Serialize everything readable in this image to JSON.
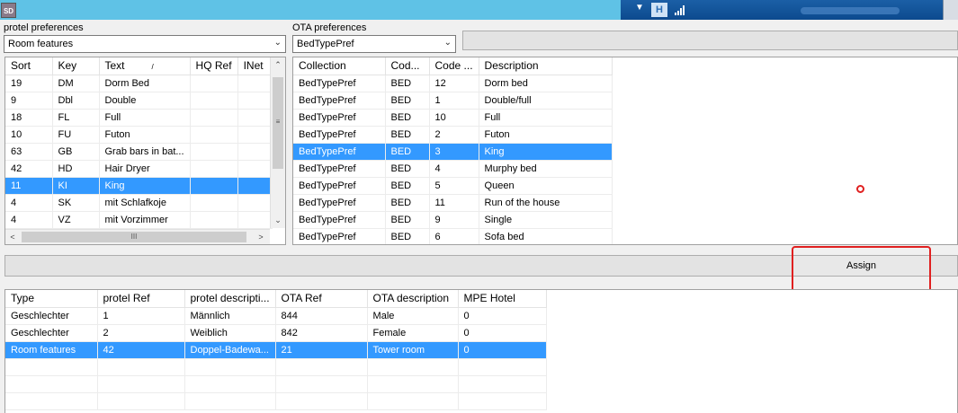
{
  "app": {
    "icon_text": "SD"
  },
  "taskbar": {
    "tray_h": "H"
  },
  "left": {
    "label": "protel preferences",
    "combo_value": "Room features",
    "columns": [
      "Sort",
      "Key",
      "Text",
      "HQ Ref",
      "INet"
    ],
    "sort_indicator": "/",
    "rows": [
      [
        "19",
        "DM",
        "Dorm Bed",
        "",
        ""
      ],
      [
        "9",
        "Dbl",
        "Double",
        "",
        ""
      ],
      [
        "18",
        "FL",
        "Full",
        "",
        ""
      ],
      [
        "10",
        "FU",
        "Futon",
        "",
        ""
      ],
      [
        "63",
        "GB",
        "Grab bars in bat...",
        "",
        ""
      ],
      [
        "42",
        "HD",
        "Hair Dryer",
        "",
        ""
      ],
      [
        "11",
        "KI",
        "King",
        "",
        ""
      ],
      [
        "4",
        "SK",
        "mit Schlafkoje",
        "",
        ""
      ],
      [
        "4",
        "VZ",
        "mit Vorzimmer",
        "",
        ""
      ]
    ],
    "selected_row": 6,
    "hscroll_grip": "III"
  },
  "ota": {
    "label": "OTA preferences",
    "combo_value": "BedTypePref",
    "columns": [
      "Collection",
      "Cod...",
      "Code ...",
      "Description"
    ],
    "rows": [
      [
        "BedTypePref",
        "BED",
        "12",
        "Dorm bed"
      ],
      [
        "BedTypePref",
        "BED",
        "1",
        "Double/full"
      ],
      [
        "BedTypePref",
        "BED",
        "10",
        "Full"
      ],
      [
        "BedTypePref",
        "BED",
        "2",
        "Futon"
      ],
      [
        "BedTypePref",
        "BED",
        "3",
        "King"
      ],
      [
        "BedTypePref",
        "BED",
        "4",
        "Murphy bed"
      ],
      [
        "BedTypePref",
        "BED",
        "5",
        "Queen"
      ],
      [
        "BedTypePref",
        "BED",
        "11",
        "Run of the house"
      ],
      [
        "BedTypePref",
        "BED",
        "9",
        "Single"
      ],
      [
        "BedTypePref",
        "BED",
        "6",
        "Sofa bed"
      ]
    ],
    "selected_row": 4
  },
  "assign_label": "Assign",
  "mapping": {
    "columns": [
      "Type",
      "protel Ref",
      "protel descripti...",
      "OTA Ref",
      "OTA description",
      "MPE Hotel"
    ],
    "rows": [
      [
        "Geschlechter",
        "1",
        "Männlich",
        "844",
        "Male",
        "0"
      ],
      [
        "Geschlechter",
        "2",
        "Weiblich",
        "842",
        "Female",
        "0"
      ],
      [
        "Room features",
        "42",
        "Doppel-Badewa...",
        "21",
        "Tower room",
        "0"
      ]
    ],
    "selected_row": 2
  },
  "colors": {
    "selection": "#3399ff",
    "titlebar": "#5fc2e6",
    "highlight_ring": "#e02020"
  }
}
